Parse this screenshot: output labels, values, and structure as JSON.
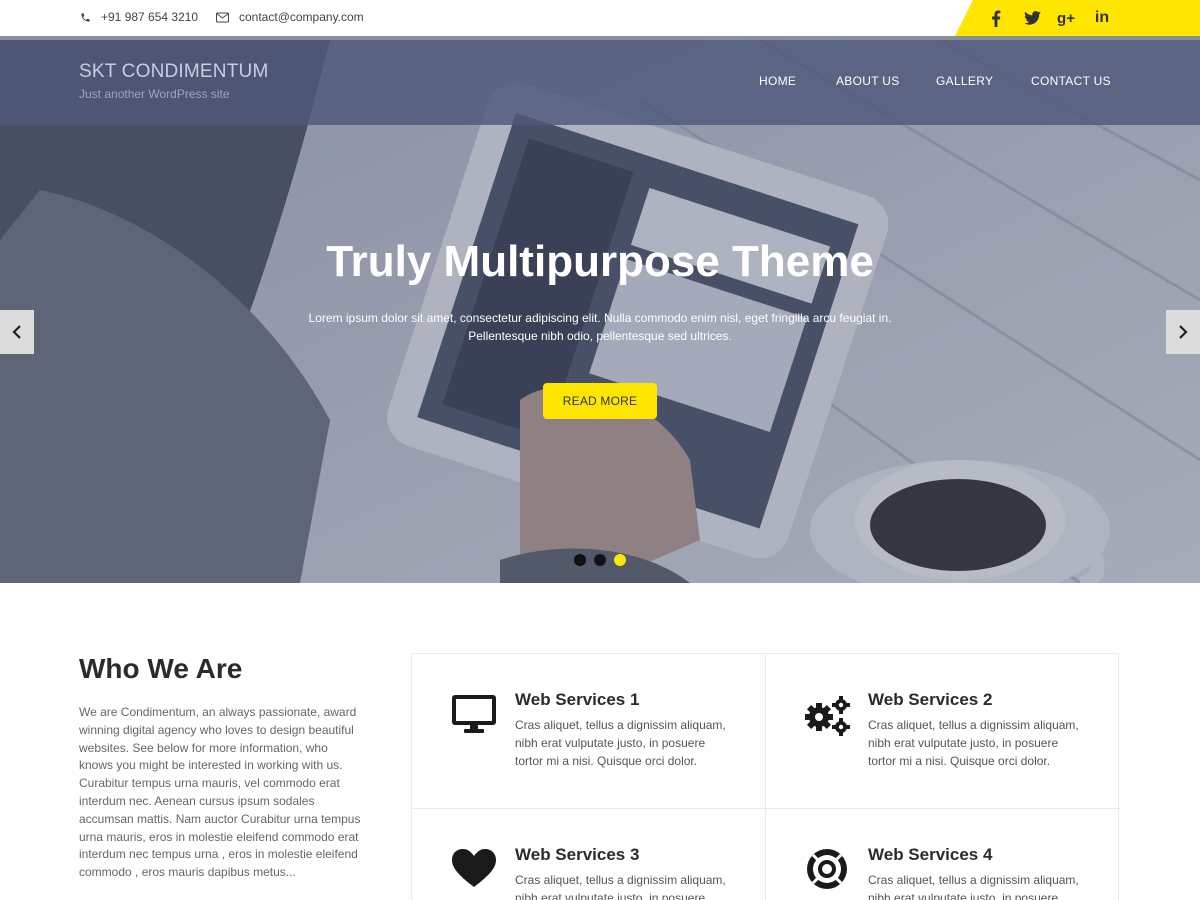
{
  "topbar": {
    "phone": "+91 987 654 3210",
    "email": "contact@company.com",
    "social": [
      "facebook-icon",
      "twitter-icon",
      "google-plus-icon",
      "linkedin-icon"
    ],
    "google_plus_glyph": "g+",
    "linkedin_glyph": "in"
  },
  "site": {
    "title": "SKT CONDIMENTUM",
    "tagline": "Just another WordPress site"
  },
  "nav": {
    "home": "HOME",
    "about": "ABOUT US",
    "gallery": "GALLERY",
    "contact": "CONTACT US"
  },
  "hero": {
    "title": "Truly Multipurpose Theme",
    "text_line1": "Lorem ipsum dolor sit amet, consectetur adipiscing elit. Nulla commodo enim nisl, eget fringilla arcu feugiat in.",
    "text_line2": "Pellentesque nibh odio, pellentesque sed ultrices.",
    "button": "READ MORE",
    "slides": 3,
    "active_slide": 3
  },
  "who": {
    "title": "Who We Are",
    "text": "We are Condimentum, an always passionate, award winning digital agency who loves to design beautiful websites. See below for more information, who knows you might be interested in working with us. Curabitur tempus urna mauris, vel commodo erat interdum nec. Aenean cursus ipsum sodales accumsan mattis. Nam auctor Curabitur urna tempus urna mauris, eros in molestie eleifend commodo erat interdum nec tempus urna , eros in molestie eleifend commodo , eros mauris dapibus metus..."
  },
  "services": [
    {
      "title": "Web Services 1",
      "icon": "monitor-icon",
      "text": "Cras aliquet, tellus a dignissim aliquam, nibh erat vulputate justo, in posuere tortor mi a nisi. Quisque orci dolor."
    },
    {
      "title": "Web Services 2",
      "icon": "gears-icon",
      "text": "Cras aliquet, tellus a dignissim aliquam, nibh erat vulputate justo, in posuere tortor mi a nisi. Quisque orci dolor."
    },
    {
      "title": "Web Services 3",
      "icon": "heart-icon",
      "text": "Cras aliquet, tellus a dignissim aliquam, nibh erat vulputate justo, in posuere tortor mi a nisi. Quisque orci dolor."
    },
    {
      "title": "Web Services 4",
      "icon": "life-ring-icon",
      "text": "Cras aliquet, tellus a dignissim aliquam, nibh erat vulputate justo, in posuere tortor mi a nisi. Quisque orci dolor."
    }
  ],
  "colors": {
    "accent": "#ffe600",
    "header_band": "#4e587a",
    "text_dark": "#2b2b2b"
  }
}
